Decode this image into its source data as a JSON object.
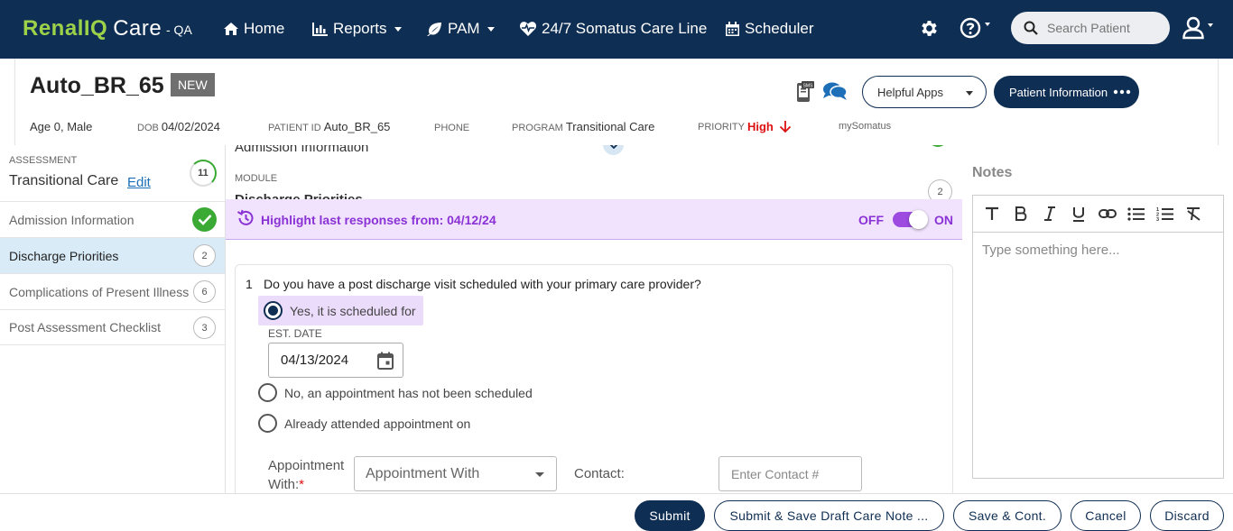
{
  "nav": {
    "brand_part1": "RenalIQ",
    "brand_part2": "Care",
    "env": "- QA",
    "items": [
      {
        "label": "Home",
        "icon": "home-icon"
      },
      {
        "label": "Reports",
        "icon": "bar-chart-icon"
      },
      {
        "label": "PAM",
        "icon": "leaf-icon"
      },
      {
        "label": "24/7 Somatus Care Line",
        "icon": "heartbeat-icon"
      },
      {
        "label": "Scheduler",
        "icon": "calendar-icon"
      }
    ],
    "search_placeholder": "Search Patient"
  },
  "patient": {
    "name": "Auto_BR_65",
    "badge": "NEW",
    "helpful_apps": "Helpful Apps",
    "patient_info": "Patient Information",
    "age_sex": "Age 0, Male",
    "dob_label": "DOB",
    "dob": "04/02/2024",
    "patient_id_label": "PATIENT ID",
    "patient_id": "Auto_BR_65",
    "phone_label": "PHONE",
    "program_label": "PROGRAM",
    "program": "Transitional Care",
    "priority_label": "PRIORITY",
    "priority": "High",
    "mysomatus": "mySomatus"
  },
  "sidebar": {
    "assessment_label": "ASSESSMENT",
    "assessment_title": "Transitional Care",
    "edit_label": "Edit",
    "total_count": "11",
    "items": [
      {
        "label": "Admission Information",
        "count": "",
        "done": true
      },
      {
        "label": "Discharge Priorities",
        "count": "2",
        "done": false
      },
      {
        "label": "Complications of Present Illness",
        "count": "6",
        "done": false
      },
      {
        "label": "Post Assessment Checklist",
        "count": "3",
        "done": false
      }
    ]
  },
  "main": {
    "prev_section": "Admission Information",
    "module_label": "MODULE",
    "module_title": "Discharge Priorities",
    "module_count": "2",
    "highlight_text": "Highlight last responses from: 04/12/24",
    "toggle_off": "OFF",
    "toggle_on": "ON",
    "question_number": "1",
    "question": "Do you have a post discharge visit scheduled with your primary care provider?",
    "options": [
      "Yes, it is scheduled for",
      "No, an appointment has not been scheduled",
      "Already attended appointment on"
    ],
    "est_date_label": "EST. DATE",
    "est_date": "04/13/2024",
    "appointment_label_1": "Appointment",
    "appointment_label_2": "With:",
    "appointment_required": "*",
    "appointment_placeholder": "Appointment With",
    "contact_label": "Contact:",
    "contact_placeholder": "Enter Contact #"
  },
  "notes": {
    "title": "Notes",
    "placeholder": "Type something here..."
  },
  "footer": {
    "submit": "Submit",
    "submit_draft": "Submit & Save Draft Care Note ...",
    "save_cont": "Save & Cont.",
    "cancel": "Cancel",
    "discard": "Discard"
  },
  "colors": {
    "navbar": "#0f2e53",
    "brand_green": "#9cd24a",
    "highlight_purple": "#8b32d6",
    "highlight_bg": "#f1e3fd",
    "priority_red": "#dd1111",
    "check_green": "#3aaa35"
  }
}
